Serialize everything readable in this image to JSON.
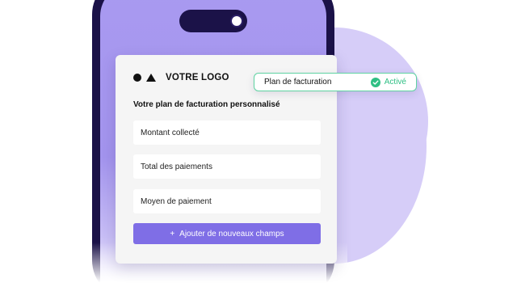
{
  "logo": {
    "text": "VOTRE LOGO"
  },
  "card": {
    "title": "Votre plan de facturation personnalisé",
    "fields": [
      "Montant collecté",
      "Total des paiements",
      "Moyen de paiement"
    ],
    "add_button": {
      "icon": "+",
      "label": "Ajouter de nouveaux champs"
    }
  },
  "status": {
    "label": "Plan de facturation",
    "value": "Activé",
    "icon": "check-circle-icon"
  },
  "colors": {
    "phone_frame": "#1b1248",
    "screen": "#a99af0",
    "accent": "#7f6ee6",
    "success": "#2fbf84",
    "blob": "#d6cdf8"
  }
}
